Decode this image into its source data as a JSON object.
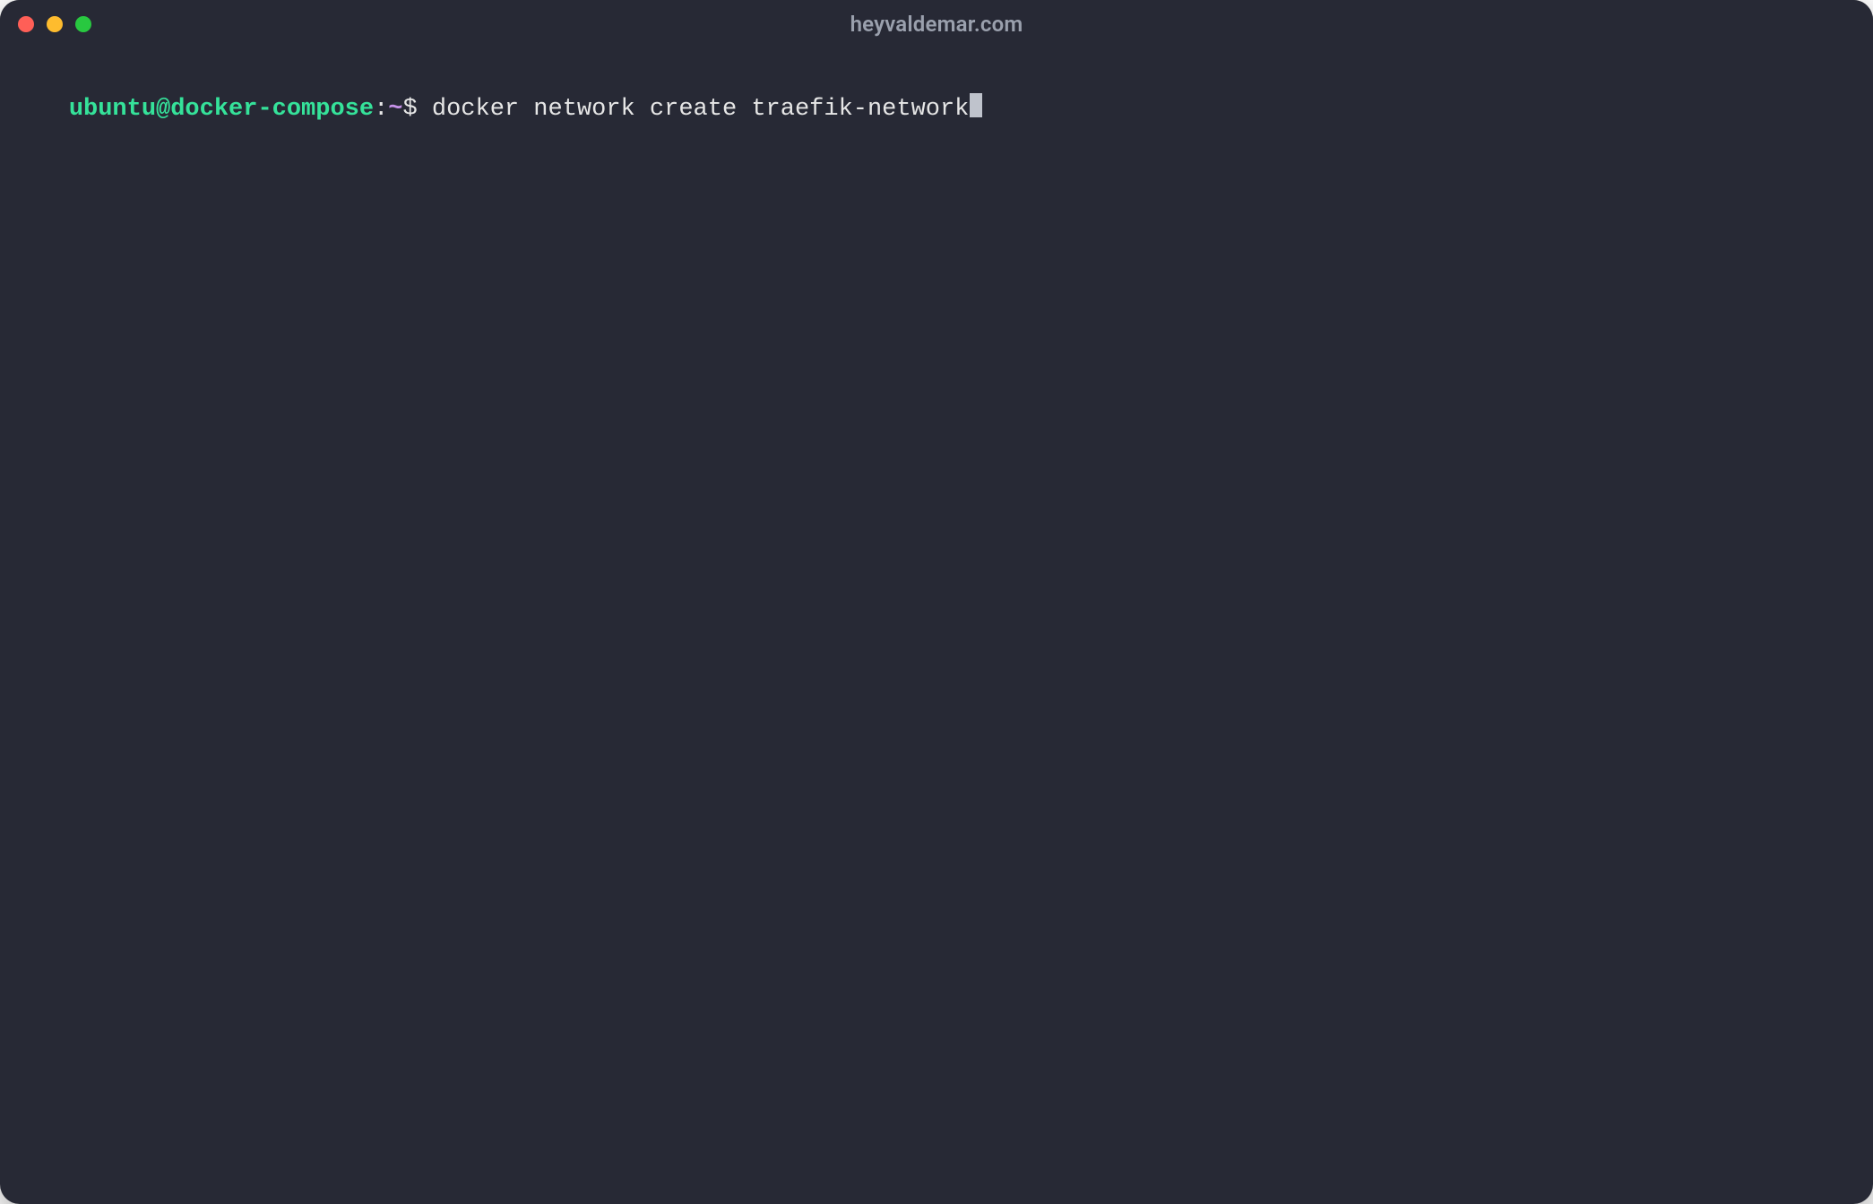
{
  "window": {
    "title": "heyvaldemar.com"
  },
  "colors": {
    "bg": "#272935",
    "text": "#e6e6e6",
    "title": "#9aa0ad",
    "user_host": "#35e29a",
    "tilde": "#c792ea",
    "traffic_red": "#ff5f57",
    "traffic_yellow": "#febc2e",
    "traffic_green": "#28c840",
    "cursor": "#bfc3cc"
  },
  "prompt": {
    "user_host": "ubuntu@docker-compose",
    "separator_before_path": ":",
    "path": "~",
    "symbol": "$",
    "space": " "
  },
  "command": "docker network create traefik-network"
}
